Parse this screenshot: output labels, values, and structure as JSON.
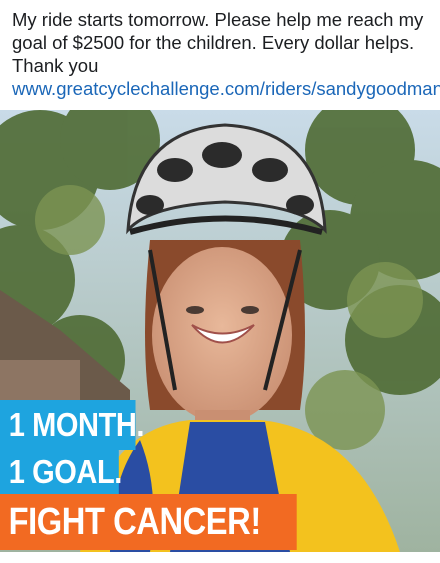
{
  "post": {
    "text": "My ride starts tomorrow. Please help me reach my goal of $2500 for the children.  Every dollar helps. Thank you ",
    "link_text": "www.greatcyclechallenge.com/riders/sandygoodman"
  },
  "photo": {
    "banner_line1": "1 MONTH.",
    "banner_line2": "1 GOAL.",
    "banner_line3": "FIGHT CANCER!"
  },
  "colors": {
    "text": "#1c1e21",
    "link": "#1b67b8",
    "banner_blue": "#1ea4df",
    "banner_orange": "#f26a22"
  }
}
